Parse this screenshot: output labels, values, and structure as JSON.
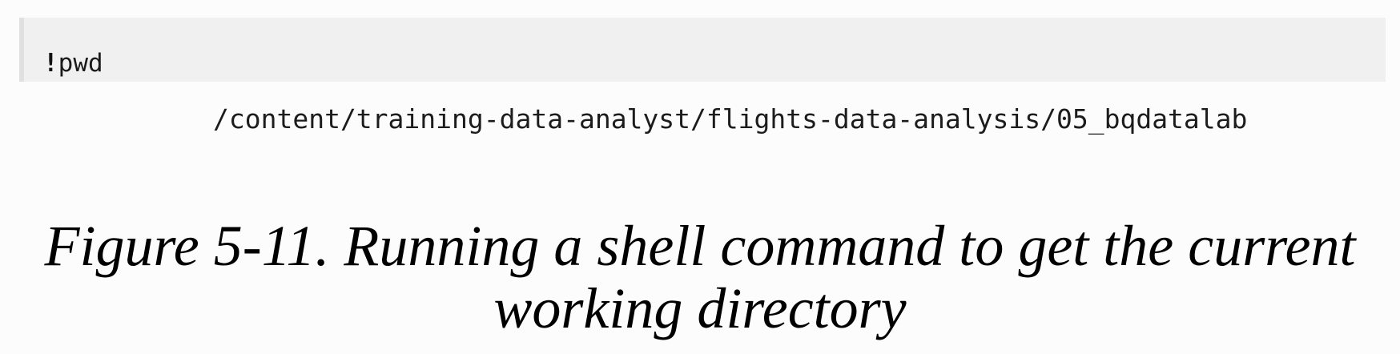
{
  "code_cell": {
    "prefix": "!",
    "command": "pwd"
  },
  "output": {
    "text": "/content/training-data-analyst/flights-data-analysis/05_bqdatalab"
  },
  "caption": {
    "label": "Figure 5-11.",
    "line1_rest": "Running a shell command to get the current",
    "line2": "working directory"
  }
}
